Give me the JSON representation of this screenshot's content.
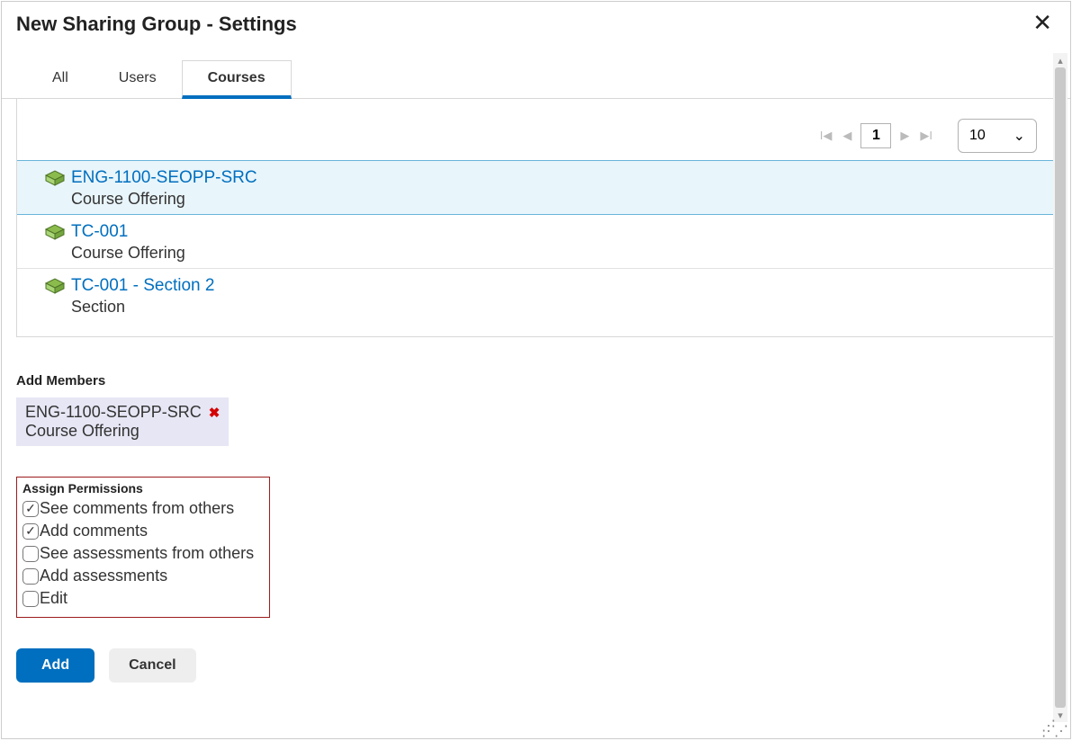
{
  "dialog": {
    "title": "New Sharing Group - Settings"
  },
  "tabs": {
    "all": "All",
    "users": "Users",
    "courses": "Courses"
  },
  "pagination": {
    "page": "1",
    "perpage": "10"
  },
  "courses": [
    {
      "name": "ENG-1100-SEOPP-SRC",
      "type": "Course Offering"
    },
    {
      "name": "TC-001",
      "type": "Course Offering"
    },
    {
      "name": "TC-001 - Section 2",
      "type": "Section"
    }
  ],
  "members": {
    "heading": "Add Members",
    "chip": {
      "title": "ENG-1100-SEOPP-SRC",
      "subtitle": "Course Offering"
    }
  },
  "permissions": {
    "heading": "Assign Permissions",
    "items": [
      {
        "label": "See comments from others",
        "checked": true
      },
      {
        "label": "Add comments",
        "checked": true
      },
      {
        "label": "See assessments from others",
        "checked": false
      },
      {
        "label": "Add assessments",
        "checked": false
      },
      {
        "label": "Edit",
        "checked": false
      }
    ]
  },
  "buttons": {
    "add": "Add",
    "cancel": "Cancel"
  }
}
